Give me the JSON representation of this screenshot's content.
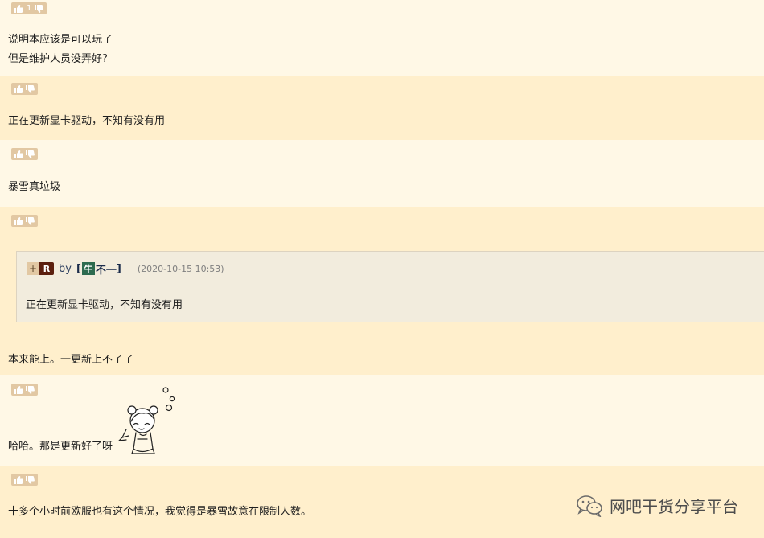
{
  "posts": [
    {
      "votes": "1",
      "lines": [
        "说明本应该是可以玩了",
        "但是维护人员没弄好?"
      ]
    },
    {
      "votes": "",
      "lines": [
        "正在更新显卡驱动，不知有没有用"
      ]
    },
    {
      "votes": "",
      "lines": [
        "暴雪真垃圾"
      ]
    },
    {
      "votes": "",
      "quote": {
        "plus": "+",
        "badge": "R",
        "by": "by",
        "name_open": "[",
        "avatar_char": "牛",
        "name": "不一",
        "name_close": "]",
        "time": "(2020-10-15 10:53)",
        "text": "正在更新显卡驱动，不知有没有用"
      },
      "lines": [
        "本来能上。一更新上不了了"
      ]
    },
    {
      "votes": "",
      "lines": [
        "哈哈。那是更新好了呀"
      ]
    },
    {
      "votes": "",
      "lines": [
        "十多个小时前欧服也有这个情况，我觉得是暴雪故意在限制人数。"
      ]
    }
  ],
  "watermark": "网吧干货分享平台",
  "icons": {
    "like": "thumbs-up-icon",
    "dislike": "thumbs-down-icon",
    "watermark": "wechat-icon",
    "sticker": "cartoon-girl-sticker"
  },
  "colors": {
    "row_light": "#fff8e6",
    "row_dark": "#ffefcc",
    "vote_bg": "#e2c8a3",
    "quote_bg": "#f2ecdd",
    "badge": "#5c1f0e",
    "avatar": "#2d6b4f"
  }
}
